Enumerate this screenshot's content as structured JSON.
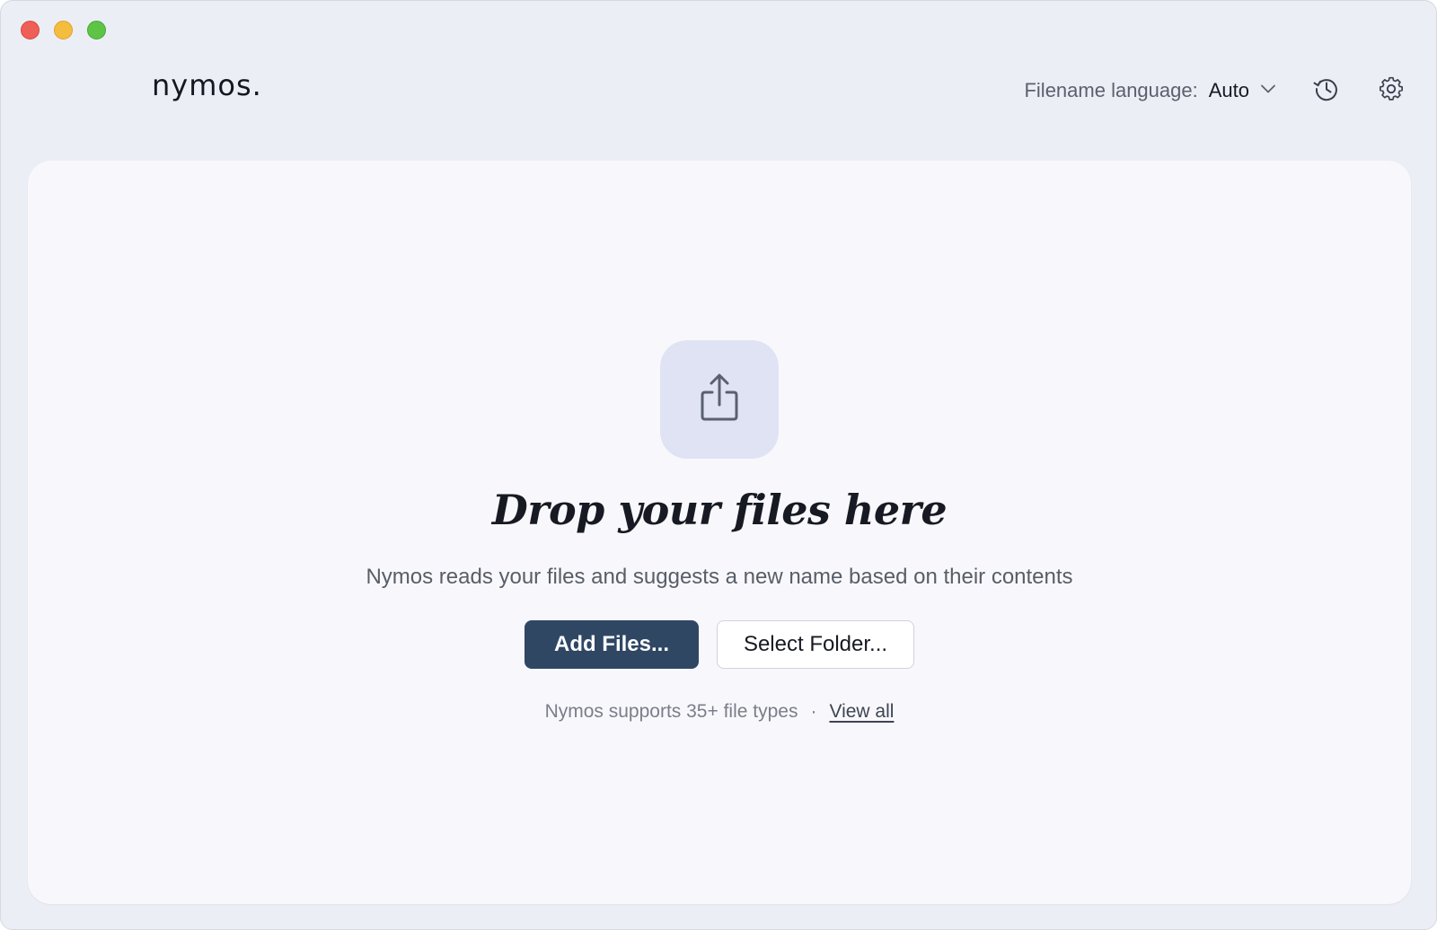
{
  "window": {
    "traffic_lights": [
      "close",
      "minimize",
      "zoom"
    ]
  },
  "header": {
    "logo": "nymos.",
    "language_label": "Filename language:",
    "language_value": "Auto",
    "icons": {
      "dropdown": "chevron-down-icon",
      "history": "history-icon",
      "settings": "gear-icon"
    }
  },
  "dropzone": {
    "icon": "share-upload-icon",
    "title": "Drop your files here",
    "subtitle": "Nymos reads your files and suggests a new name based on their contents",
    "add_files_label": "Add Files...",
    "select_folder_label": "Select Folder...",
    "supported_text": "Nymos supports 35+ file types",
    "separator": "·",
    "view_all_label": "View all"
  },
  "colors": {
    "window_bg": "#eceef6",
    "card_bg": "#f8f8fc",
    "primary_button": "#2f4763",
    "upload_tile": "#dfe3f3"
  }
}
